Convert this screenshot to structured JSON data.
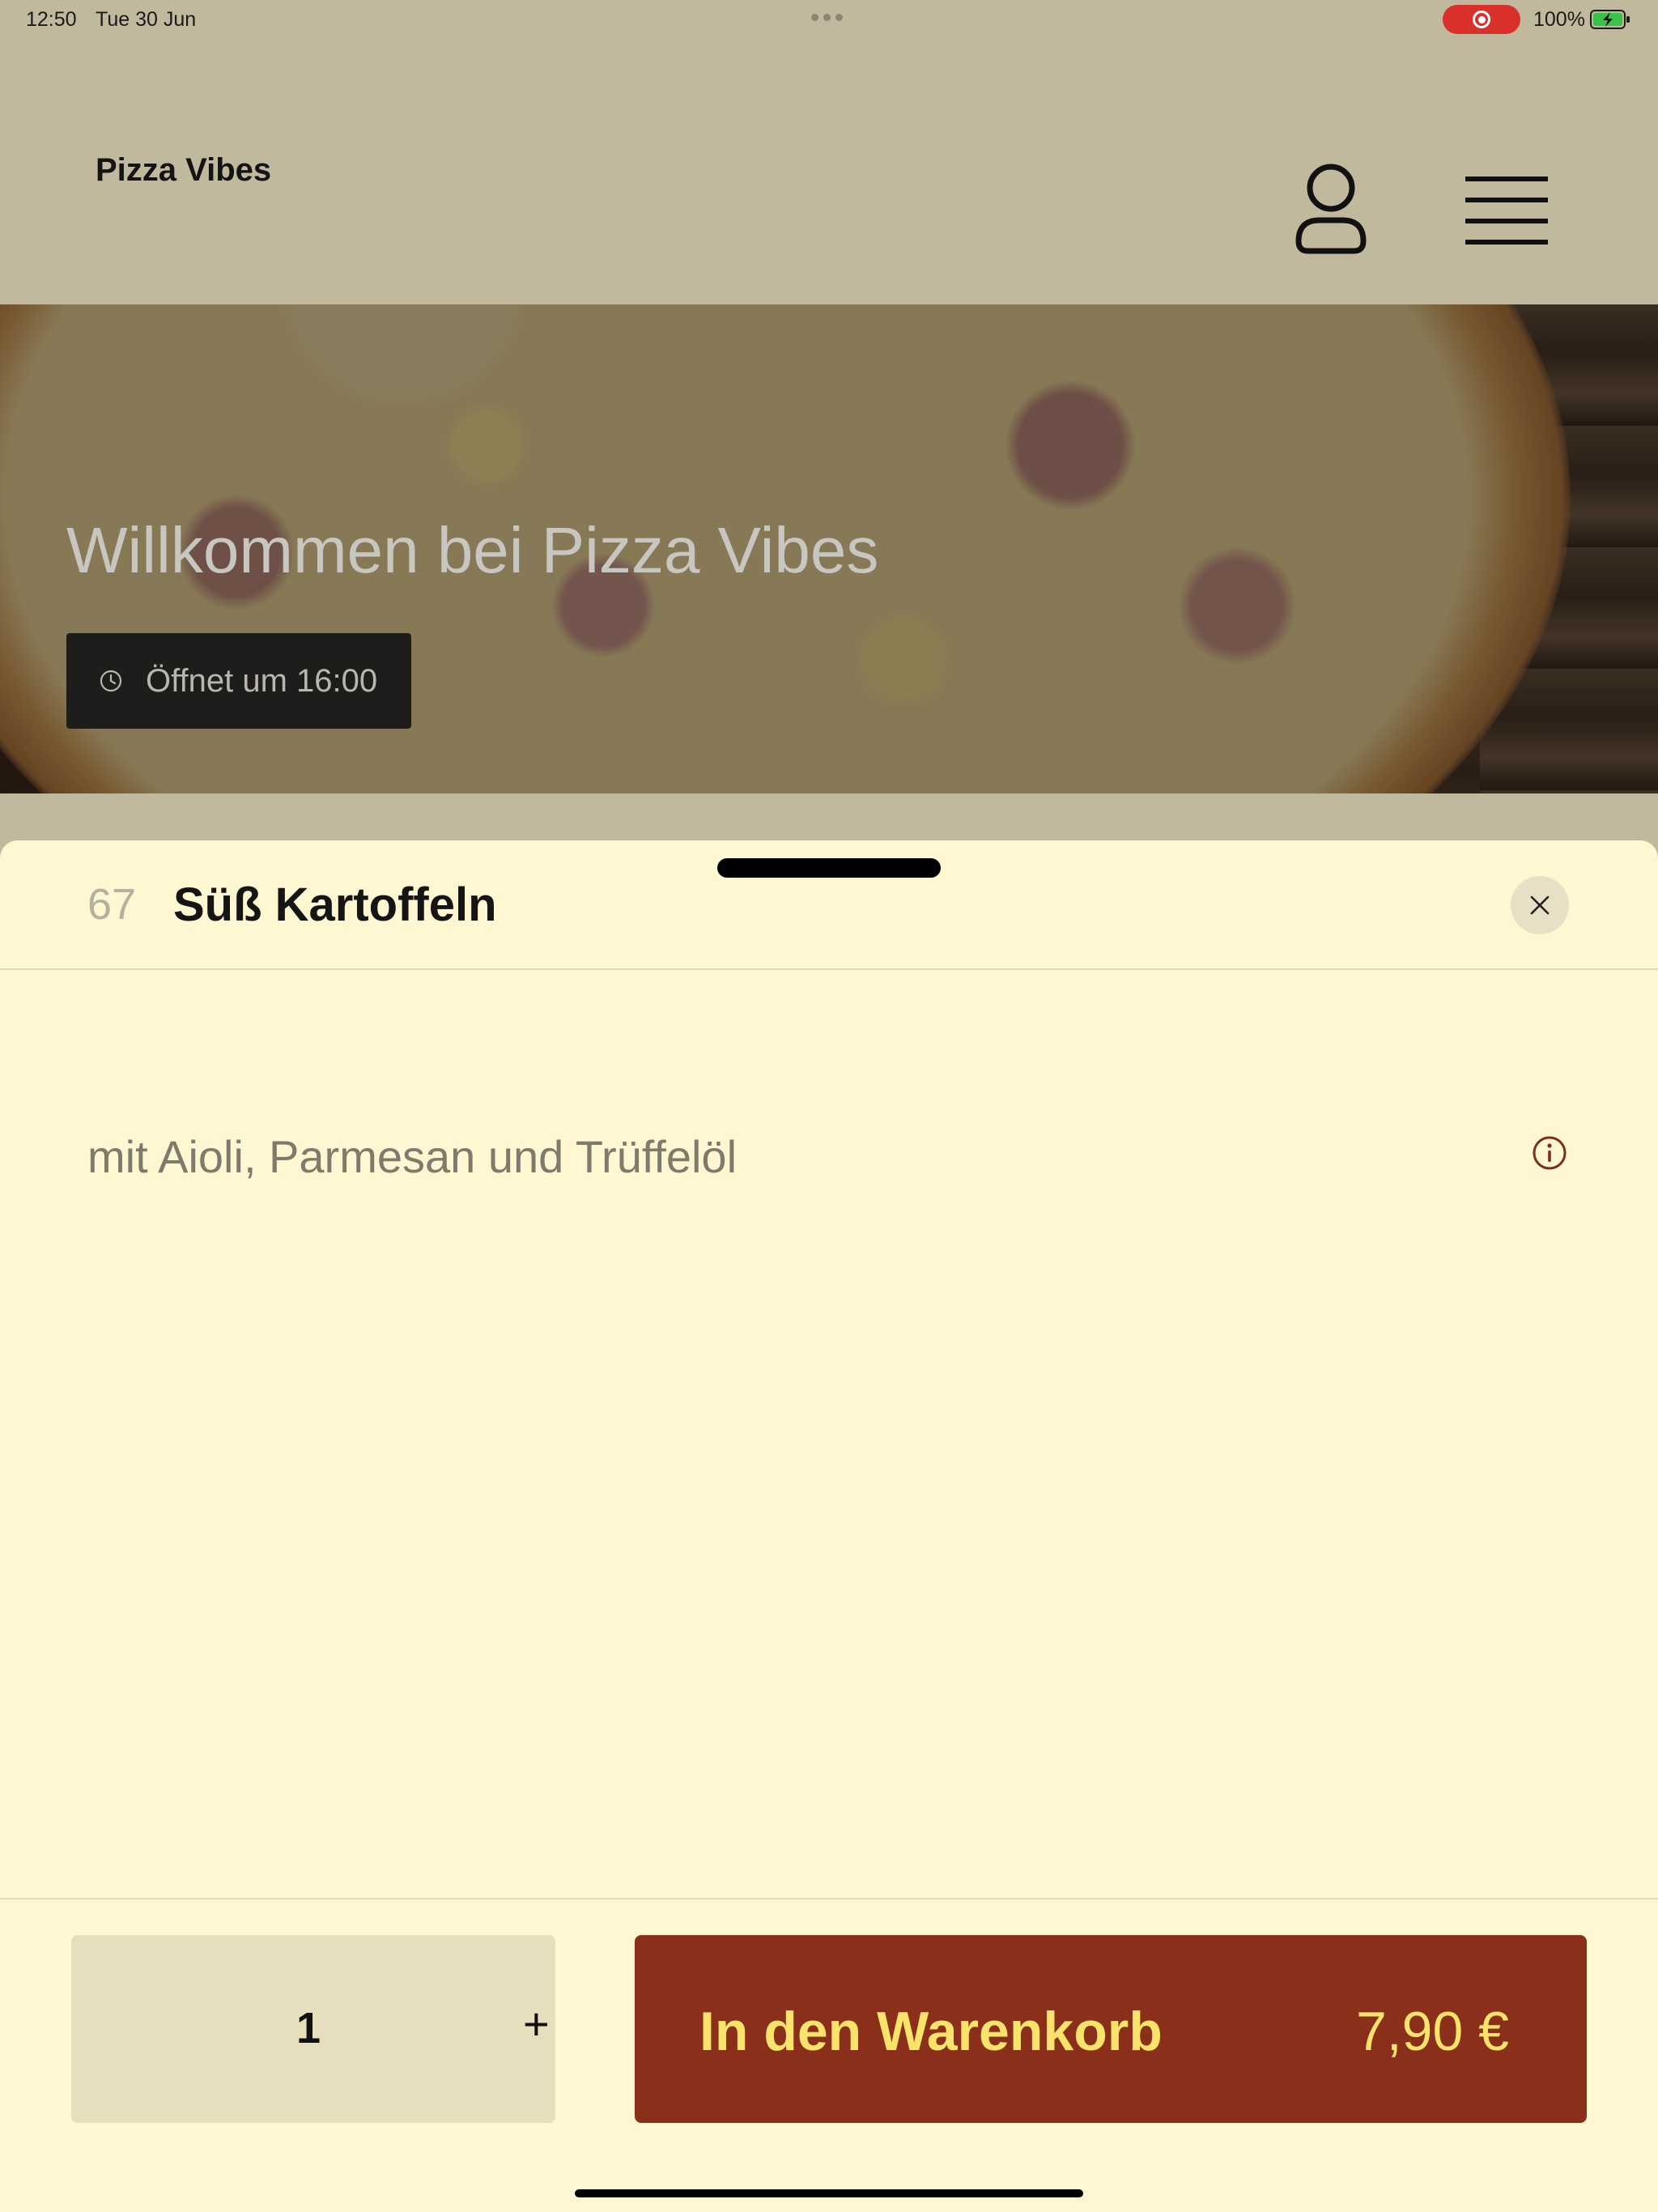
{
  "status_bar": {
    "time": "12:50",
    "date": "Tue 30 Jun",
    "battery_percent": "100%",
    "recording_color": "#d9302c"
  },
  "header": {
    "brand": "Pizza Vibes",
    "user_icon": "person-outline-icon",
    "menu_icon": "hamburger-menu-icon"
  },
  "hero": {
    "title": "Willkommen bei Pizza Vibes",
    "hours_icon": "clock-icon",
    "hours_text": "Öffnet um 16:00"
  },
  "sheet": {
    "item_number": "67",
    "item_title": "Süß Kartoffeln",
    "description": "mit Aioli, Parmesan und Trüffelöl",
    "close_icon": "close-icon",
    "info_icon": "info-icon",
    "quantity": "1",
    "plus_label": "+",
    "add_to_cart_label": "In den Warenkorb",
    "price": "7,90 €"
  },
  "colors": {
    "header_bg": "#c0b99e",
    "sheet_bg": "#fff7d1",
    "cta_bg": "#8a2f1a",
    "cta_text": "#f9e36a",
    "qty_bg": "#e6dfbe"
  }
}
